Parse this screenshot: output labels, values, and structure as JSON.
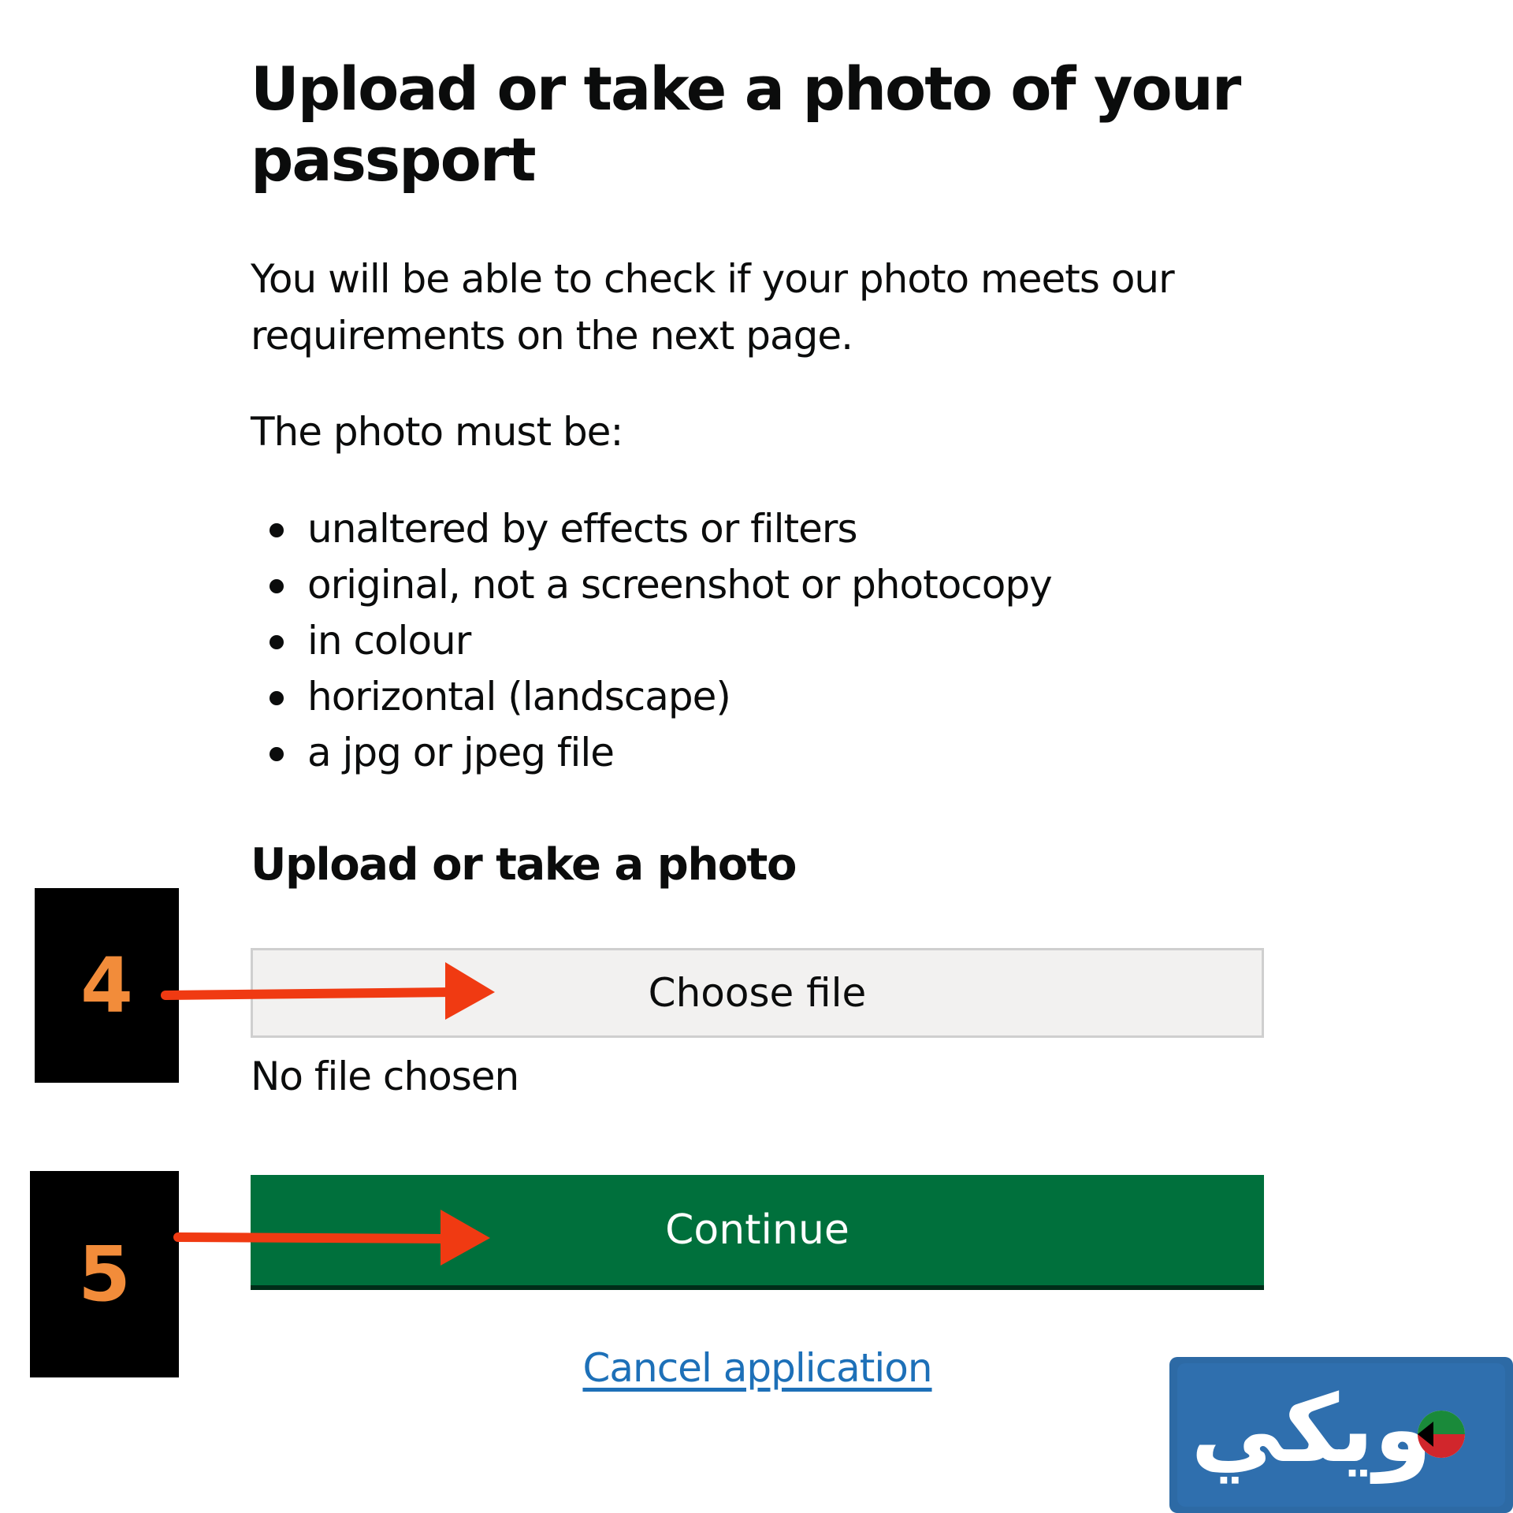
{
  "page": {
    "title": "Upload or take a photo of your passport",
    "intro": "You will be able to check if your photo meets our requirements on the next page.",
    "must_be": "The photo must be:",
    "requirements": [
      "unaltered by effects or filters",
      "original, not a screenshot or photocopy",
      "in colour",
      "horizontal (landscape)",
      "a jpg or jpeg file"
    ],
    "upload_heading": "Upload or take a photo",
    "choose_file_label": "Choose file",
    "file_status": "No file chosen",
    "continue_label": "Continue",
    "cancel_label": "Cancel application"
  },
  "annotations": {
    "step_4": "4",
    "step_5": "5",
    "arrow_color": "#f03a12",
    "step_number_color": "#f28c3a"
  },
  "logo": {
    "text": "ويكي",
    "background": "#2d6aa5"
  },
  "colors": {
    "continue_button": "#00703c",
    "link": "#1d70b8",
    "file_button": "#f2f1f0"
  }
}
